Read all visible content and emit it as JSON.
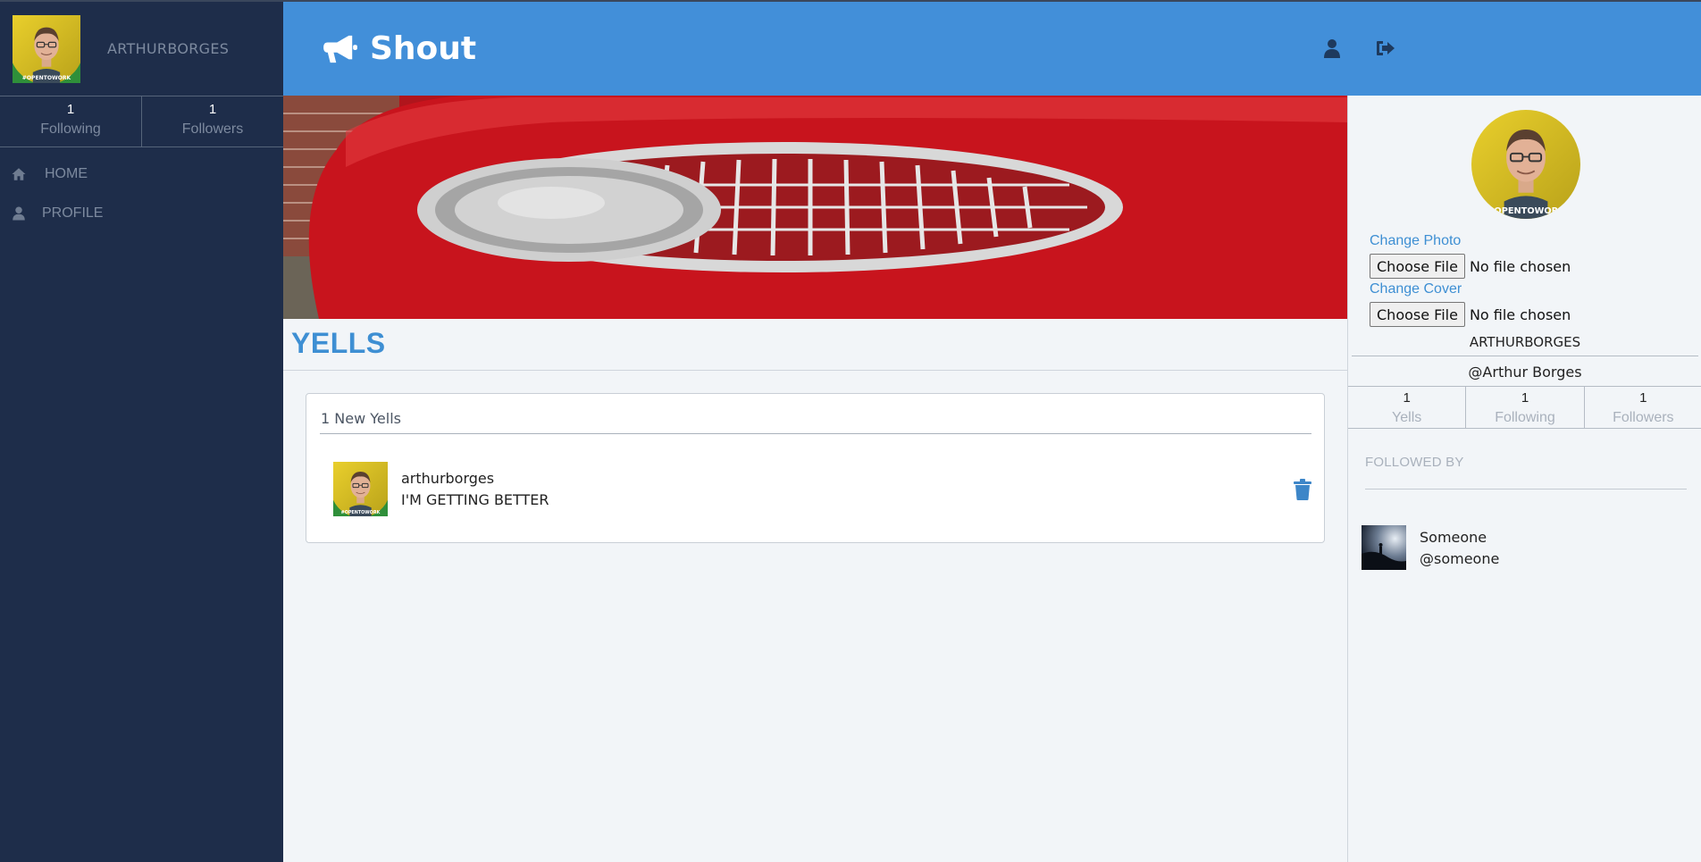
{
  "app": {
    "brand": "Shout"
  },
  "sidebar": {
    "username": "ARTHURBORGES",
    "stats": [
      {
        "value": "1",
        "label": "Following"
      },
      {
        "value": "1",
        "label": "Followers"
      }
    ],
    "nav": [
      {
        "label": "HOME",
        "icon": "home-icon"
      },
      {
        "label": "PROFILE",
        "icon": "user-icon"
      }
    ]
  },
  "header": {
    "icons": [
      "user-icon",
      "sign-out-icon"
    ]
  },
  "main": {
    "section_title": "YELLS",
    "feed": {
      "header": "1 New Yells",
      "yells": [
        {
          "username": "arthurborges",
          "text": "I'M GETTING BETTER",
          "icon": "trash-icon"
        }
      ]
    }
  },
  "profile_panel": {
    "change_photo_label": "Change Photo",
    "change_cover_label": "Change Cover",
    "file_button_label": "Choose File",
    "file_status": "No file chosen",
    "name": "ARTHURBORGES",
    "handle": "@Arthur Borges",
    "stats": [
      {
        "value": "1",
        "label": "Yells"
      },
      {
        "value": "1",
        "label": "Following"
      },
      {
        "value": "1",
        "label": "Followers"
      }
    ],
    "followed_by_title": "FOLLOWED BY",
    "followers": [
      {
        "name": "Someone",
        "handle": "@someone"
      }
    ]
  },
  "colors": {
    "sidebar": "#1e2d4a",
    "header": "#428fd9",
    "accent": "#3e8fd3",
    "background": "#f2f5f8"
  }
}
